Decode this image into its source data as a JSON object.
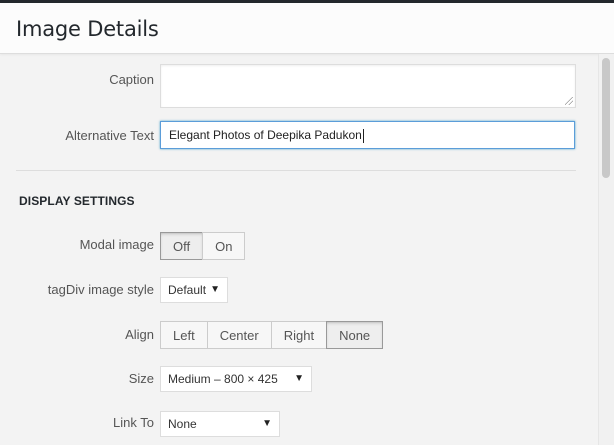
{
  "header": {
    "title": "Image Details"
  },
  "form": {
    "caption_label": "Caption",
    "caption_value": "",
    "alt_label": "Alternative Text",
    "alt_value": "Elegant Photos of Deepika Padukon"
  },
  "display_settings": {
    "title": "DISPLAY SETTINGS",
    "modal": {
      "label": "Modal image",
      "options": [
        "Off",
        "On"
      ],
      "selected": "Off"
    },
    "style": {
      "label": "tagDiv image style",
      "value": "Default"
    },
    "align": {
      "label": "Align",
      "options": [
        "Left",
        "Center",
        "Right",
        "None"
      ],
      "selected": "None"
    },
    "size": {
      "label": "Size",
      "value": "Medium – 800 × 425"
    },
    "link": {
      "label": "Link To",
      "value": "None"
    }
  },
  "icons": {
    "dropdown": "chevron-down-icon",
    "resize": "resize-grip-icon"
  }
}
